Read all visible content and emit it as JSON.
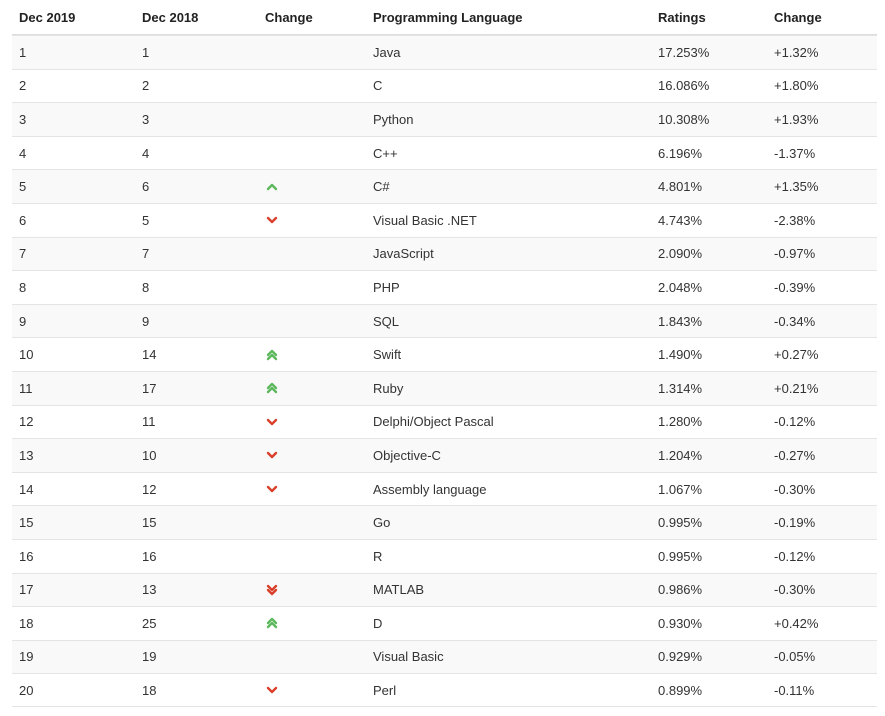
{
  "colors": {
    "up": "#5cb85c",
    "down": "#d9402b",
    "header_text": "#222222",
    "text": "#333333",
    "stripe": "#f9f9f9",
    "border": "#e4e4e4"
  },
  "table": {
    "headers": {
      "dec2019": "Dec 2019",
      "dec2018": "Dec 2018",
      "change": "Change",
      "language": "Programming Language",
      "ratings": "Ratings",
      "rating_change": "Change"
    },
    "rows": [
      {
        "dec2019": "1",
        "dec2018": "1",
        "trend": "none",
        "trend_icon": "",
        "language": "Java",
        "rating": "17.253%",
        "change": "+1.32%"
      },
      {
        "dec2019": "2",
        "dec2018": "2",
        "trend": "none",
        "trend_icon": "",
        "language": "C",
        "rating": "16.086%",
        "change": "+1.80%"
      },
      {
        "dec2019": "3",
        "dec2018": "3",
        "trend": "none",
        "trend_icon": "",
        "language": "Python",
        "rating": "10.308%",
        "change": "+1.93%"
      },
      {
        "dec2019": "4",
        "dec2018": "4",
        "trend": "none",
        "trend_icon": "",
        "language": "C++",
        "rating": "6.196%",
        "change": "-1.37%"
      },
      {
        "dec2019": "5",
        "dec2018": "6",
        "trend": "up",
        "trend_icon": "chevron-up-icon",
        "language": "C#",
        "rating": "4.801%",
        "change": "+1.35%"
      },
      {
        "dec2019": "6",
        "dec2018": "5",
        "trend": "down",
        "trend_icon": "chevron-down-icon",
        "language": "Visual Basic .NET",
        "rating": "4.743%",
        "change": "-2.38%"
      },
      {
        "dec2019": "7",
        "dec2018": "7",
        "trend": "none",
        "trend_icon": "",
        "language": "JavaScript",
        "rating": "2.090%",
        "change": "-0.97%"
      },
      {
        "dec2019": "8",
        "dec2018": "8",
        "trend": "none",
        "trend_icon": "",
        "language": "PHP",
        "rating": "2.048%",
        "change": "-0.39%"
      },
      {
        "dec2019": "9",
        "dec2018": "9",
        "trend": "none",
        "trend_icon": "",
        "language": "SQL",
        "rating": "1.843%",
        "change": "-0.34%"
      },
      {
        "dec2019": "10",
        "dec2018": "14",
        "trend": "double-up",
        "trend_icon": "double-chevron-up-icon",
        "language": "Swift",
        "rating": "1.490%",
        "change": "+0.27%"
      },
      {
        "dec2019": "11",
        "dec2018": "17",
        "trend": "double-up",
        "trend_icon": "double-chevron-up-icon",
        "language": "Ruby",
        "rating": "1.314%",
        "change": "+0.21%"
      },
      {
        "dec2019": "12",
        "dec2018": "11",
        "trend": "down",
        "trend_icon": "chevron-down-icon",
        "language": "Delphi/Object Pascal",
        "rating": "1.280%",
        "change": "-0.12%"
      },
      {
        "dec2019": "13",
        "dec2018": "10",
        "trend": "down",
        "trend_icon": "chevron-down-icon",
        "language": "Objective-C",
        "rating": "1.204%",
        "change": "-0.27%"
      },
      {
        "dec2019": "14",
        "dec2018": "12",
        "trend": "down",
        "trend_icon": "chevron-down-icon",
        "language": "Assembly language",
        "rating": "1.067%",
        "change": "-0.30%"
      },
      {
        "dec2019": "15",
        "dec2018": "15",
        "trend": "none",
        "trend_icon": "",
        "language": "Go",
        "rating": "0.995%",
        "change": "-0.19%"
      },
      {
        "dec2019": "16",
        "dec2018": "16",
        "trend": "none",
        "trend_icon": "",
        "language": "R",
        "rating": "0.995%",
        "change": "-0.12%"
      },
      {
        "dec2019": "17",
        "dec2018": "13",
        "trend": "double-down",
        "trend_icon": "double-chevron-down-icon",
        "language": "MATLAB",
        "rating": "0.986%",
        "change": "-0.30%"
      },
      {
        "dec2019": "18",
        "dec2018": "25",
        "trend": "double-up",
        "trend_icon": "double-chevron-up-icon",
        "language": "D",
        "rating": "0.930%",
        "change": "+0.42%"
      },
      {
        "dec2019": "19",
        "dec2018": "19",
        "trend": "none",
        "trend_icon": "",
        "language": "Visual Basic",
        "rating": "0.929%",
        "change": "-0.05%"
      },
      {
        "dec2019": "20",
        "dec2018": "18",
        "trend": "down",
        "trend_icon": "chevron-down-icon",
        "language": "Perl",
        "rating": "0.899%",
        "change": "-0.11%"
      }
    ]
  }
}
